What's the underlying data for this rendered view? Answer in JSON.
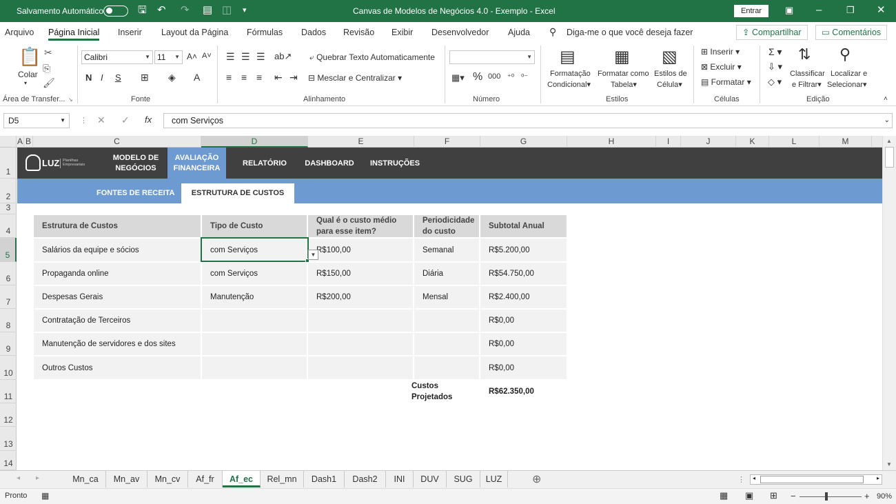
{
  "titlebar": {
    "autosave": "Salvamento Automático",
    "title": "Canvas de Modelos de Negócios 4.0 - Exemplo  -  Excel",
    "signin": "Entrar"
  },
  "menu": {
    "tabs": [
      "Arquivo",
      "Página Inicial",
      "Inserir",
      "Layout da Página",
      "Fórmulas",
      "Dados",
      "Revisão",
      "Exibir",
      "Desenvolvedor",
      "Ajuda"
    ],
    "search": "Diga-me o que você deseja fazer",
    "share": "Compartilhar",
    "comments": "Comentários"
  },
  "ribbon": {
    "paste": "Colar",
    "clipboard": "Área de Transfer...",
    "font_name": "Calibri",
    "font_size": "11",
    "font_group": "Fonte",
    "bold": "N",
    "italic": "I",
    "underline": "S",
    "wrap": "Quebrar Texto Automaticamente",
    "merge": "Mesclar e Centralizar",
    "align_group": "Alinhamento",
    "number_group": "Número",
    "cond_format_1": "Formatação",
    "cond_format_2": "Condicional",
    "format_table_1": "Formatar como",
    "format_table_2": "Tabela",
    "cell_styles_1": "Estilos de",
    "cell_styles_2": "Célula",
    "styles_group": "Estilos",
    "insert": "Inserir",
    "delete": "Excluir",
    "format": "Formatar",
    "cells_group": "Células",
    "sort_1": "Classificar",
    "sort_2": "e Filtrar",
    "find_1": "Localizar e",
    "find_2": "Selecionar",
    "edit_group": "Edição"
  },
  "formula": {
    "namebox": "D5",
    "content": "com Serviços"
  },
  "columns": [
    "A",
    "B",
    "C",
    "D",
    "E",
    "F",
    "G",
    "H",
    "I",
    "J",
    "K",
    "L",
    "M"
  ],
  "rows": [
    "1",
    "2",
    "3",
    "4",
    "5",
    "6",
    "7",
    "8",
    "9",
    "10",
    "11",
    "12",
    "13",
    "14"
  ],
  "sheet": {
    "logo": "LUZ",
    "logo_sub": "Planilhas Empresariais",
    "nav": [
      {
        "line1": "MODELO DE",
        "line2": "NEGÓCIOS"
      },
      {
        "line1": "AVALIAÇÃO",
        "line2": "FINANCEIRA"
      },
      {
        "line1": "RELATÓRIO",
        "line2": ""
      },
      {
        "line1": "DASHBOARD",
        "line2": ""
      },
      {
        "line1": "INSTRUÇÕES",
        "line2": ""
      }
    ],
    "subnav": [
      "FONTES DE RECEITA",
      "ESTRUTURA DE CUSTOS"
    ],
    "headers": [
      "Estrutura de Custos",
      "Tipo de Custo",
      "Qual é o custo médio para esse item?",
      "Periodicidade do custo",
      "Subtotal Anual"
    ],
    "table": [
      [
        "Salários da equipe e sócios",
        "com Serviços",
        "R$100,00",
        "Semanal",
        "R$5.200,00"
      ],
      [
        "Propaganda online",
        "com Serviços",
        "R$150,00",
        "Diária",
        "R$54.750,00"
      ],
      [
        "Despesas Gerais",
        "Manutenção",
        "R$200,00",
        "Mensal",
        "R$2.400,00"
      ],
      [
        "Contratação de Terceiros",
        "",
        "",
        "",
        "R$0,00"
      ],
      [
        "Manutenção de servidores e dos sites",
        "",
        "",
        "",
        "R$0,00"
      ],
      [
        "Outros Custos",
        "",
        "",
        "",
        "R$0,00"
      ]
    ],
    "total_label": "Custos Projetados",
    "total_value": "R$62.350,00"
  },
  "sheettabs": [
    "Mn_ca",
    "Mn_av",
    "Mn_cv",
    "Af_fr",
    "Af_ec",
    "Rel_mn",
    "Dash1",
    "Dash2",
    "INI",
    "DUV",
    "SUG",
    "LUZ"
  ],
  "active_sheet": "Af_ec",
  "status": {
    "ready": "Pronto",
    "zoom": "90%"
  },
  "colors": {
    "excel_green": "#217346",
    "nav_dark": "#404040",
    "nav_blue": "#6d9ad0"
  }
}
